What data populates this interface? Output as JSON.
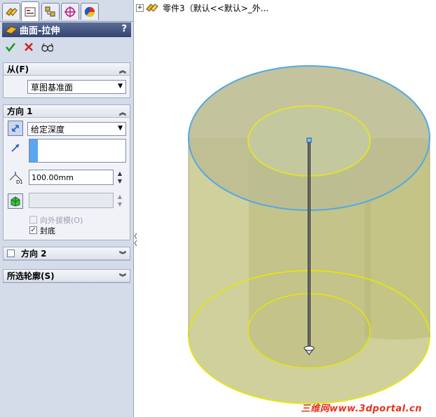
{
  "panel": {
    "title": "曲面-拉伸",
    "help": "?",
    "tabs": [
      "feature-manager-icon",
      "property-manager-icon",
      "configuration-manager-icon",
      "dimxpert-icon",
      "display-manager-icon"
    ],
    "from": {
      "header": "从(F)",
      "select_value": "草图基准面"
    },
    "direction1": {
      "header": "方向 1",
      "end_condition": "给定深度",
      "depth": "100.00mm",
      "draft_outward_label": "向外拔模(O)",
      "cap_end_label": "封底",
      "cap_end_checked": true,
      "draft_checked": false
    },
    "direction2": {
      "header": "方向 2",
      "checked": false
    },
    "selected_contours": {
      "header": "所选轮廓(S)"
    }
  },
  "tree": {
    "label": "零件3（默认<<默认>_外..."
  },
  "watermark": "三维网www.3dportal.cn",
  "colors": {
    "title_bar": "#3c4d78",
    "body_fill": "#c8c88c",
    "edge_yellow": "#ffff00",
    "edge_blue": "#52a8e6"
  }
}
